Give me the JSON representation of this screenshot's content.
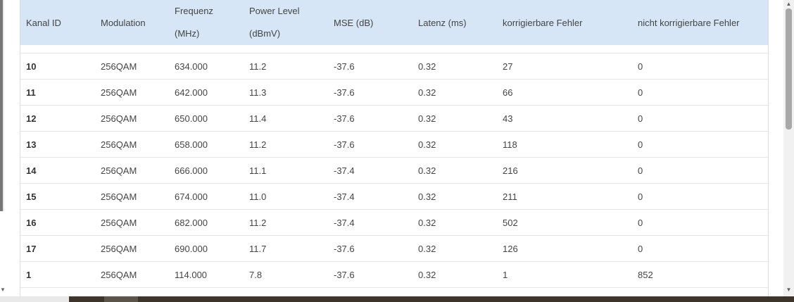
{
  "table": {
    "headers": {
      "kanal_id": "Kanal ID",
      "modulation": "Modulation",
      "frequenz_l1": "Frequenz",
      "frequenz_l2": "(MHz)",
      "power_l1": "Power Level",
      "power_l2": "(dBmV)",
      "mse": "MSE (dB)",
      "latenz": "Latenz (ms)",
      "korr": "korrigierbare Fehler",
      "nicht_korr": "nicht korrigierbare Fehler"
    },
    "rows": [
      {
        "id": "10",
        "mod": "256QAM",
        "freq": "634.000",
        "power": "11.2",
        "mse": "-37.6",
        "lat": "0.32",
        "korr": "27",
        "nkorr": "0"
      },
      {
        "id": "11",
        "mod": "256QAM",
        "freq": "642.000",
        "power": "11.3",
        "mse": "-37.6",
        "lat": "0.32",
        "korr": "66",
        "nkorr": "0"
      },
      {
        "id": "12",
        "mod": "256QAM",
        "freq": "650.000",
        "power": "11.4",
        "mse": "-37.6",
        "lat": "0.32",
        "korr": "43",
        "nkorr": "0"
      },
      {
        "id": "13",
        "mod": "256QAM",
        "freq": "658.000",
        "power": "11.2",
        "mse": "-37.6",
        "lat": "0.32",
        "korr": "118",
        "nkorr": "0"
      },
      {
        "id": "14",
        "mod": "256QAM",
        "freq": "666.000",
        "power": "11.1",
        "mse": "-37.4",
        "lat": "0.32",
        "korr": "216",
        "nkorr": "0"
      },
      {
        "id": "15",
        "mod": "256QAM",
        "freq": "674.000",
        "power": "11.0",
        "mse": "-37.4",
        "lat": "0.32",
        "korr": "211",
        "nkorr": "0"
      },
      {
        "id": "16",
        "mod": "256QAM",
        "freq": "682.000",
        "power": "11.2",
        "mse": "-37.4",
        "lat": "0.32",
        "korr": "502",
        "nkorr": "0"
      },
      {
        "id": "17",
        "mod": "256QAM",
        "freq": "690.000",
        "power": "11.7",
        "mse": "-37.6",
        "lat": "0.32",
        "korr": "126",
        "nkorr": "0"
      },
      {
        "id": "1",
        "mod": "256QAM",
        "freq": "114.000",
        "power": "7.8",
        "mse": "-37.6",
        "lat": "0.32",
        "korr": "1",
        "nkorr": "852"
      }
    ]
  },
  "icons": {
    "scroll_up": "triangle-up",
    "scroll_down": "triangle-down"
  },
  "colors": {
    "header_bg": "#d6e6f6"
  }
}
